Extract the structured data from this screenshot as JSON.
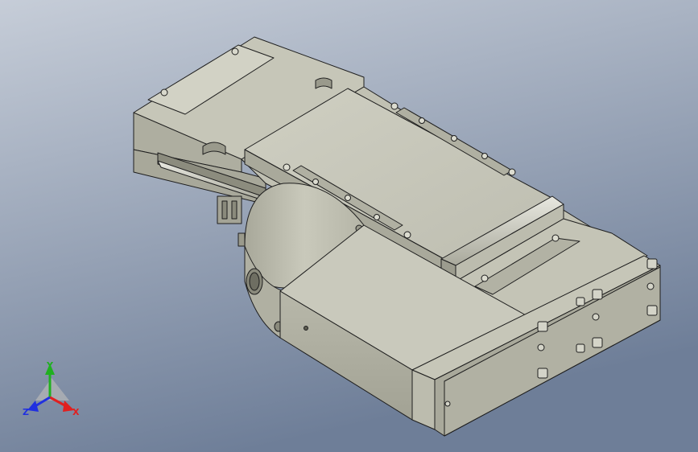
{
  "viewport": {
    "background_top": "#c3cad6",
    "background_bottom": "#6f7f99",
    "model_face_light": "#c8c8ba",
    "model_face_mid": "#b4b4a6",
    "model_face_dark": "#8e8e80",
    "edge_color": "#1e1e1e"
  },
  "triad": {
    "x_label": "X",
    "y_label": "Y",
    "z_label": "Z",
    "x_color": "#e02020",
    "y_color": "#20b020",
    "z_color": "#2030e0"
  }
}
